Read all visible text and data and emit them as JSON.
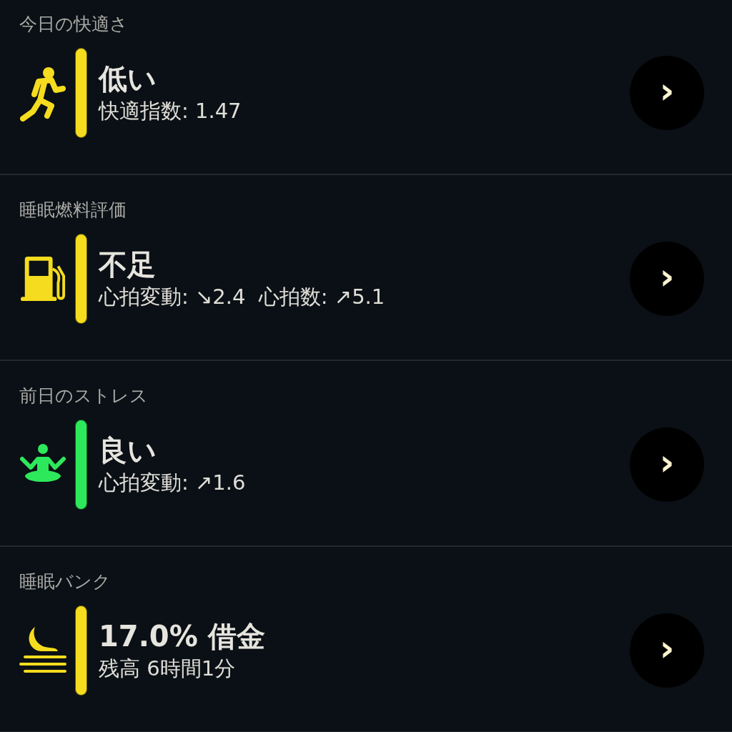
{
  "cards": [
    {
      "heading": "今日の快適さ",
      "kind": "comfort",
      "color": "#f5dc1e",
      "title": "低い",
      "detail": "快適指数: 1.47",
      "button": "›"
    },
    {
      "heading": "睡眠燃料評価",
      "kind": "fuel",
      "color": "#f5dc1e",
      "title": "不足",
      "detail": "心拍変動: ↘2.4  心拍数: ↗5.1",
      "button": "›"
    },
    {
      "heading": "前日のストレス",
      "kind": "stress",
      "color": "#2de85a",
      "title": "良い",
      "detail": "心拍変動: ↗1.6",
      "button": "›"
    },
    {
      "heading": "睡眠バンク",
      "kind": "bank",
      "color": "#f5dc1e",
      "title": "17.0% 借金",
      "detail": "残高 6時間1分",
      "button": "›"
    }
  ]
}
